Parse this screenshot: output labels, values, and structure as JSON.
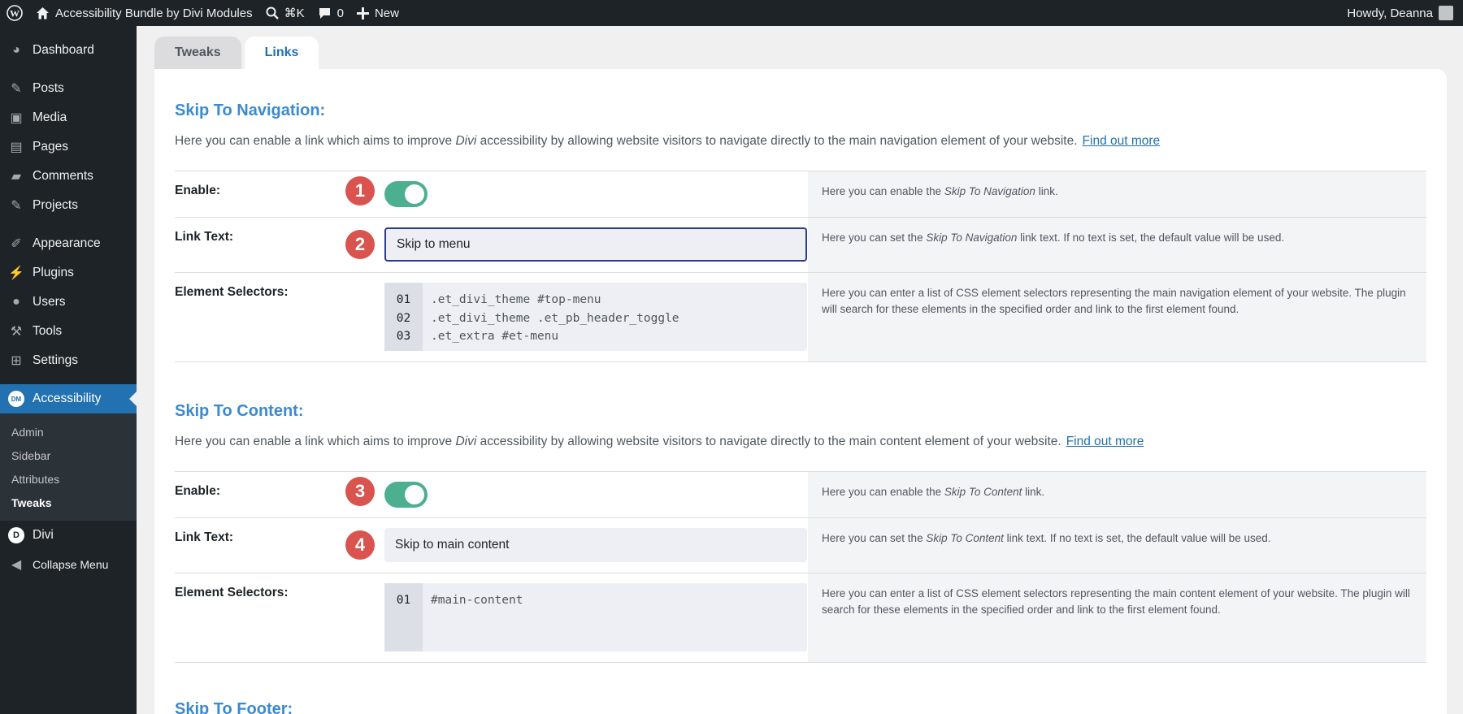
{
  "adminbar": {
    "site_name": "Accessibility Bundle by Divi Modules",
    "search_shortcut": "⌘K",
    "comments_count": "0",
    "new_label": "New",
    "greeting": "Howdy, Deanna"
  },
  "sidebar": {
    "items": [
      {
        "label": "Dashboard",
        "icon": "dashboard-icon"
      },
      {
        "label": "Posts",
        "icon": "pin-icon"
      },
      {
        "label": "Media",
        "icon": "media-icon"
      },
      {
        "label": "Pages",
        "icon": "pages-icon"
      },
      {
        "label": "Comments",
        "icon": "comment-icon"
      },
      {
        "label": "Projects",
        "icon": "pin-icon"
      },
      {
        "label": "Appearance",
        "icon": "brush-icon"
      },
      {
        "label": "Plugins",
        "icon": "plug-icon"
      },
      {
        "label": "Users",
        "icon": "user-icon"
      },
      {
        "label": "Tools",
        "icon": "wrench-icon"
      },
      {
        "label": "Settings",
        "icon": "settings-icon"
      },
      {
        "label": "Accessibility",
        "icon": "dm-badge-icon",
        "active": true
      },
      {
        "label": "Divi",
        "icon": "divi-icon"
      },
      {
        "label": "Collapse Menu",
        "icon": "collapse-icon"
      }
    ],
    "dm_badge": "DM",
    "divi_badge": "D",
    "submenu": [
      "Admin",
      "Sidebar",
      "Attributes",
      "Tweaks"
    ],
    "submenu_current": "Tweaks"
  },
  "tabs": [
    "Tweaks",
    "Links"
  ],
  "active_tab": "Links",
  "sections": [
    {
      "title": "Skip To Navigation:",
      "desc_prefix": "Here you can enable a link which aims to improve ",
      "desc_em": "Divi",
      "desc_suffix": " accessibility by allowing website visitors to navigate directly to the main navigation element of your website.",
      "link": "Find out more",
      "enable_label": "Enable:",
      "enable_marker": "1",
      "enable_on": true,
      "enable_help_prefix": "Here you can enable the ",
      "enable_help_em": "Skip To Navigation",
      "enable_help_suffix": " link.",
      "linktext_label": "Link Text:",
      "linktext_marker": "2",
      "linktext_value": "Skip to menu",
      "linktext_help_prefix": "Here you can set the ",
      "linktext_help_em": "Skip To Navigation",
      "linktext_help_suffix": " link text. If no text is set, the default value will be used.",
      "selectors_label": "Element Selectors:",
      "selector_line_numbers": [
        "01",
        "02",
        "03"
      ],
      "selector_lines": [
        ".et_divi_theme #top-menu",
        ".et_divi_theme .et_pb_header_toggle",
        ".et_extra #et-menu"
      ],
      "selectors_help": "Here you can enter a list of CSS element selectors representing the main navigation element of your website. The plugin will search for these elements in the specified order and link to the first element found."
    },
    {
      "title": "Skip To Content:",
      "desc_prefix": "Here you can enable a link which aims to improve ",
      "desc_em": "Divi",
      "desc_suffix": " accessibility by allowing website visitors to navigate directly to the main content element of your website.",
      "link": "Find out more",
      "enable_label": "Enable:",
      "enable_marker": "3",
      "enable_on": true,
      "enable_help_prefix": "Here you can enable the ",
      "enable_help_em": "Skip To Content",
      "enable_help_suffix": " link.",
      "linktext_label": "Link Text:",
      "linktext_marker": "4",
      "linktext_value": "Skip to main content",
      "linktext_help_prefix": "Here you can set the ",
      "linktext_help_em": "Skip To Content",
      "linktext_help_suffix": " link text. If no text is set, the default value will be used.",
      "selectors_label": "Element Selectors:",
      "selector_line_numbers": [
        "01"
      ],
      "selector_lines": [
        "#main-content"
      ],
      "selectors_help": "Here you can enter a list of CSS element selectors representing the main content element of your website. The plugin will search for these elements in the specified order and link to the first element found."
    }
  ],
  "next_section_title": "Skip To Footer:",
  "colors": {
    "accent": "#2271b1",
    "section_title": "#3a8ad0",
    "toggle_on": "#4caf8f",
    "marker": "#d9534f",
    "adminbar": "#1d2327"
  }
}
